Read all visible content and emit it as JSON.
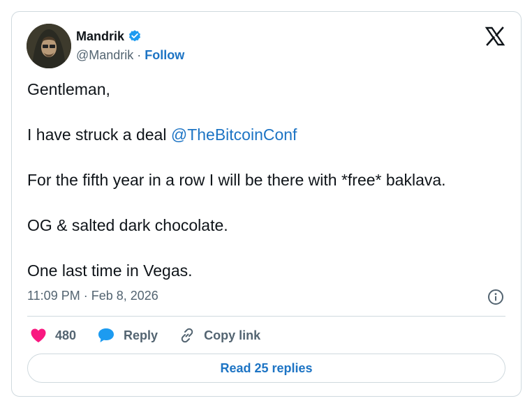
{
  "author": {
    "display_name": "Mandrik",
    "handle": "@Mandrik",
    "separator": "·",
    "follow_label": "Follow",
    "verified_icon": "verified-badge-icon",
    "verified_color": "#1d9bf0"
  },
  "platform_icon": "x-logo-icon",
  "tweet": {
    "lines": [
      {
        "text": "Gentleman,"
      },
      {
        "text": "I have struck a deal ",
        "mention": "@TheBitcoinConf"
      },
      {
        "text": "For the fifth year in a row I will be there with *free* baklava."
      },
      {
        "text": "OG & salted dark chocolate."
      },
      {
        "text": "One last time in Vegas."
      }
    ],
    "timestamp": "11:09 PM · Feb 8, 2026"
  },
  "actions": {
    "likes_count": "480",
    "reply_label": "Reply",
    "copy_link_label": "Copy link",
    "like_color": "#f91880",
    "reply_color": "#1d9bf0"
  },
  "read_replies_label": "Read 25 replies",
  "colors": {
    "text": "#0f1419",
    "muted": "#536471",
    "link": "#1d74c4",
    "border": "#cfd9de"
  }
}
